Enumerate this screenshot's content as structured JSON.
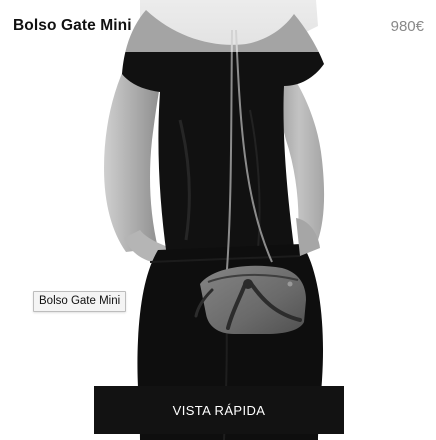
{
  "product": {
    "name": "Bolso Gate Mini",
    "price": "980€"
  },
  "image": {
    "hover_label": "Bolso Gate Mini"
  },
  "actions": {
    "quick_view_label": "VISTA RÁPIDA"
  },
  "colors": {
    "background": "#ffffff",
    "button_bg": "#121212",
    "button_text": "#ffffff",
    "price_text": "#888888",
    "name_text": "#111111"
  }
}
